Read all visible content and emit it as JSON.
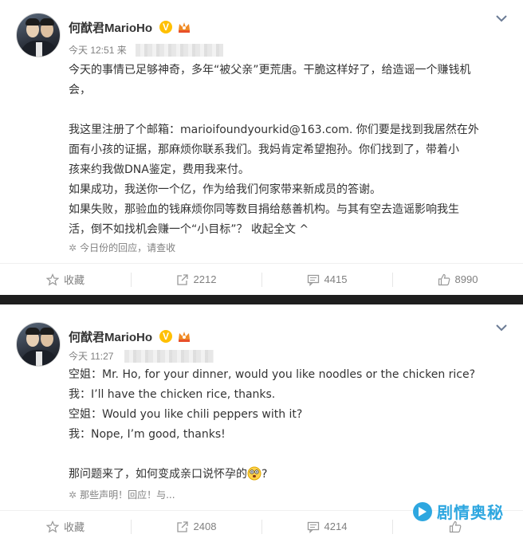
{
  "posts": [
    {
      "author": "何猷君MarioHo",
      "time": "今天 12:51",
      "source_prefix": "来",
      "lines": [
        "今天的事情已足够神奇，多年“被父亲”更荒唐。干脆这样好了，给造谣一个赚钱机",
        "会，",
        "",
        "我这里注册了个邮箱：marioifoundyourkid@163.com. 你们要是找到我居然在外",
        "面有小孩的证据，那麻烦你联系我们。我妈肯定希望抱孙。你们找到了，带着小",
        "孩来约我做DNA鉴定，费用我来付。",
        "如果成功，我送你一个亿，作为给我们何家带来新成员的答谢。",
        "如果失败，那验血的钱麻烦你同等数目捐给慈善机构。与其有空去造谣影响我生",
        "活，倒不如找机会赚一个“小目标”？"
      ],
      "collapse_label": "收起全文 ^",
      "reply_hint": "今日份的回应，请查收",
      "actions": {
        "favorite": "收藏",
        "repost": "2212",
        "comment": "4415",
        "like": "8990"
      }
    },
    {
      "author": "何猷君MarioHo",
      "time": "今天 11:27",
      "lines": [
        "空姐：Mr. Ho, for your dinner, would you like noodles or the chicken rice?",
        "我：I’ll have the chicken rice, thanks.",
        "空姐：Would you like chili peppers with it?",
        "我：Nope, I’m good, thanks!",
        "",
        "那问题来了，如何变成亲口说怀孕的"
      ],
      "trailing_text": "?",
      "reply_hint": "那些声明！回应！与...",
      "actions": {
        "favorite": "收藏",
        "repost": "2408",
        "comment": "4214",
        "like": ""
      }
    }
  ],
  "watermark": "剧情奥秘",
  "icons": {
    "verified": "V",
    "reply_star": "✲"
  },
  "colors": {
    "verified_badge": "#ffc000",
    "meta_gray": "#808080",
    "divider": "#1e1e1e",
    "watermark": "#2ea7e0"
  }
}
